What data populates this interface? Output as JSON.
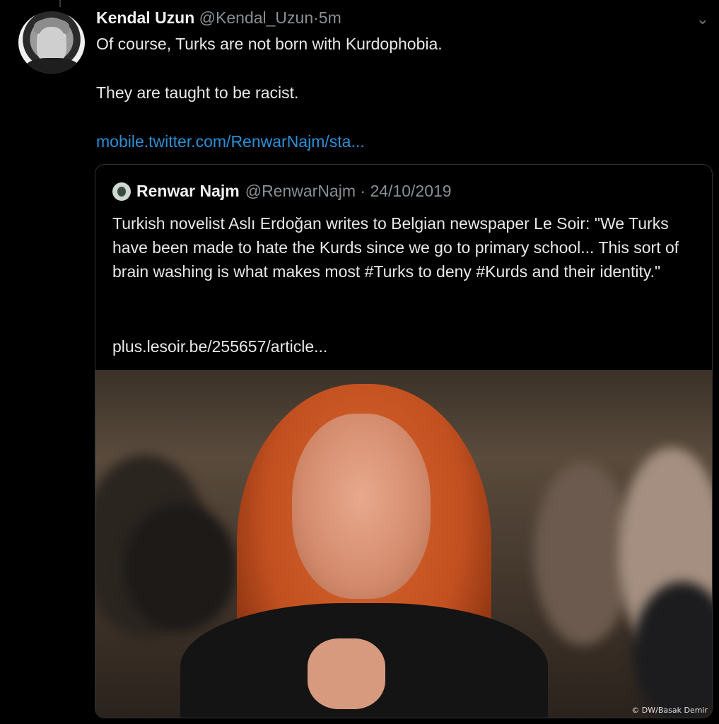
{
  "tweet": {
    "author_name": "Kendal Uzun",
    "author_handle": "@Kendal_Uzun",
    "separator": "·",
    "time": "5m",
    "text_line1": "Of course, Turks are not born with Kurdophobia.",
    "text_line2": "They are taught to be racist.",
    "link": "mobile.twitter.com/RenwarNajm/sta..."
  },
  "quoted_tweet": {
    "author_name": "Renwar Najm",
    "author_handle": "@RenwarNajm",
    "separator": "·",
    "date": "24/10/2019",
    "text": "Turkish novelist Aslı Erdoğan writes to Belgian newspaper Le Soir: \"We Turks have been made to hate the Kurds since we go to primary school... This sort of brain washing is what makes most #Turks to deny #Kurds and their identity.\"",
    "link": "plus.lesoir.be/255657/article...",
    "photo_credit": "© DW/Basak Demir"
  },
  "icons": {
    "caret": "chevron-down-icon"
  }
}
